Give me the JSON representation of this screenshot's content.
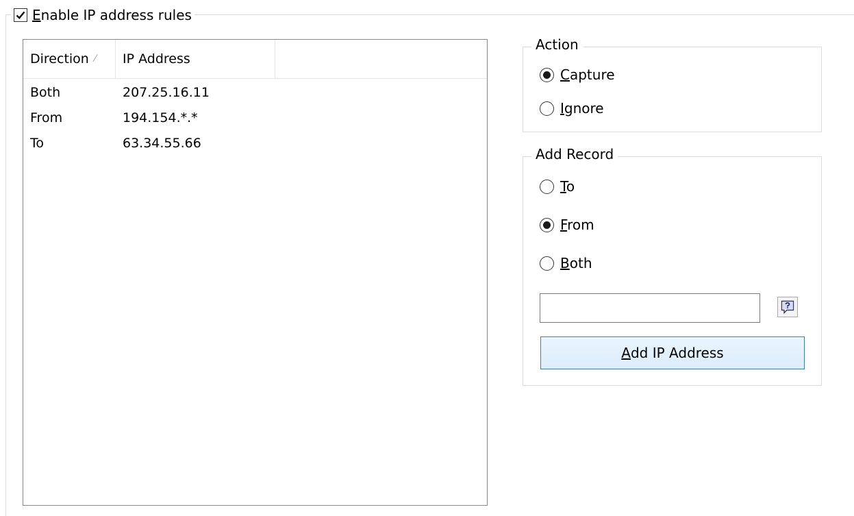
{
  "enable": {
    "checked": true,
    "label_accel": "E",
    "label_rest": "nable IP address rules"
  },
  "list": {
    "columns": {
      "direction": "Direction",
      "ip": "IP Address"
    },
    "sort_indicator": "⁄",
    "rows": [
      {
        "direction": "Both",
        "ip": "207.25.16.11"
      },
      {
        "direction": "From",
        "ip": "194.154.*.*"
      },
      {
        "direction": "To",
        "ip": "63.34.55.66"
      }
    ]
  },
  "action": {
    "title": "Action",
    "capture": {
      "accel": "C",
      "rest": "apture",
      "selected": true
    },
    "ignore": {
      "accel": "I",
      "rest": "gnore",
      "selected": false
    }
  },
  "add_record": {
    "title": "Add Record",
    "to": {
      "accel": "T",
      "rest": "o",
      "selected": false
    },
    "from": {
      "accel": "F",
      "rest": "rom",
      "selected": true
    },
    "both": {
      "accel": "B",
      "rest": "oth",
      "selected": false
    },
    "ip_value": "",
    "help_icon": "help-icon",
    "button": {
      "accel": "A",
      "rest": "dd IP Address"
    }
  },
  "colors": {
    "button_border": "#3c7fb1",
    "button_fill": "#dcecfc",
    "frame": "#dcdcdc"
  }
}
